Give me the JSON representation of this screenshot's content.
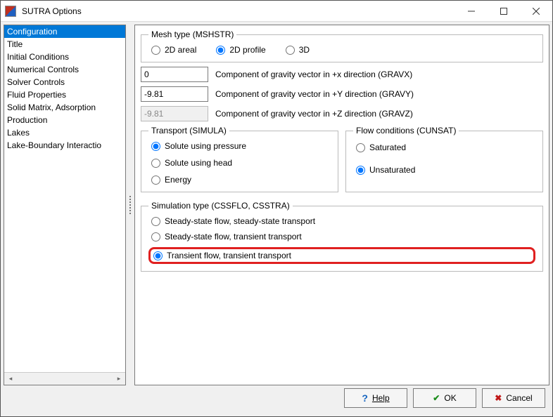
{
  "window": {
    "title": "SUTRA Options"
  },
  "sidebar": {
    "items": [
      "Configuration",
      "Title",
      "Initial Conditions",
      "Numerical Controls",
      "Solver Controls",
      "Fluid Properties",
      "Solid Matrix, Adsorption",
      "Production",
      "Lakes",
      "Lake-Boundary Interactio"
    ],
    "selected_index": 0
  },
  "mesh": {
    "legend": "Mesh type (MSHSTR)",
    "options": [
      "2D areal",
      "2D profile",
      "3D"
    ],
    "selected": "2D profile"
  },
  "gravity": {
    "x": {
      "value": "0",
      "label": "Component of gravity vector in +x direction (GRAVX)",
      "enabled": true
    },
    "y": {
      "value": "-9.81",
      "label": "Component of gravity vector in +Y direction (GRAVY)",
      "enabled": true
    },
    "z": {
      "value": "-9.81",
      "label": "Component of gravity vector in +Z direction (GRAVZ)",
      "enabled": false
    }
  },
  "transport": {
    "legend": "Transport (SIMULA)",
    "options": [
      "Solute using pressure",
      "Solute using head",
      "Energy"
    ],
    "selected": "Solute using pressure"
  },
  "flow": {
    "legend": "Flow conditions (CUNSAT)",
    "options": [
      "Saturated",
      "Unsaturated"
    ],
    "selected": "Unsaturated"
  },
  "simtype": {
    "legend": "Simulation type (CSSFLO, CSSTRA)",
    "options": [
      "Steady-state flow, steady-state transport",
      "Steady-state flow, transient transport",
      "Transient flow, transient transport"
    ],
    "selected": "Transient flow, transient transport",
    "highlighted": "Transient flow, transient transport"
  },
  "buttons": {
    "help": "Help",
    "ok": "OK",
    "cancel": "Cancel"
  }
}
